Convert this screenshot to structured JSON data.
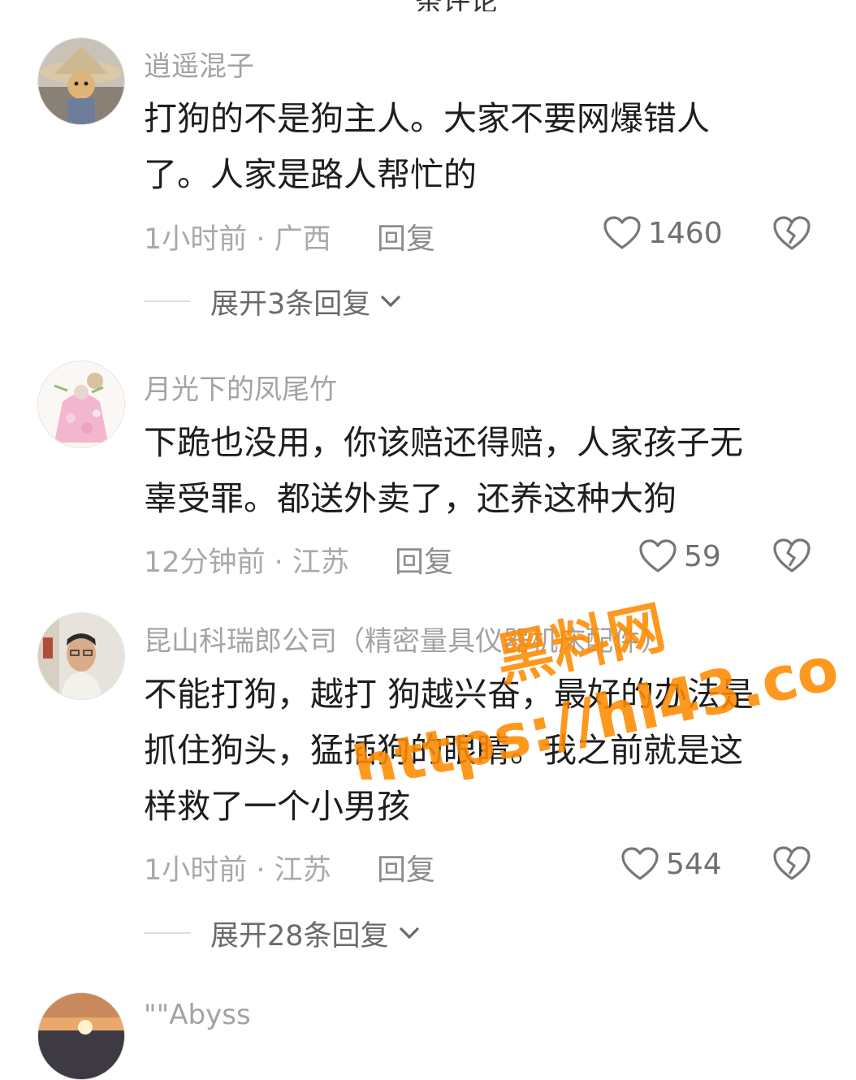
{
  "header": {
    "partial_title": "条评论"
  },
  "comments": [
    {
      "username": "逍遥混子",
      "lines": [
        "打狗的不是狗主人。大家不要网爆错人",
        "了。人家是路人帮忙的"
      ],
      "time_location": "1小时前 · 广西",
      "reply_label": "回复",
      "likes": "1460",
      "expand_label": "展开3条回复"
    },
    {
      "username": "月光下的凤尾竹",
      "lines": [
        "下跪也没用，你该赔还得赔，人家孩子无",
        "辜受罪。都送外卖了，还养这种大狗"
      ],
      "time_location": "12分钟前 · 江苏",
      "reply_label": "回复",
      "likes": "59"
    },
    {
      "username": "昆山科瑞郎公司（精密量具仪器机床配件）",
      "lines": [
        "不能打狗，越打 狗越兴奋，最好的办法是",
        "抓住狗头，猛插狗的眼睛。我之前就是这",
        "样救了一个小男孩"
      ],
      "time_location": "1小时前 · 江苏",
      "reply_label": "回复",
      "likes": "544",
      "expand_label": "展开28条回复"
    },
    {
      "username": "\"\"Abyss"
    }
  ],
  "watermark": {
    "line1": "黑料网",
    "line2": "https://hl43.co",
    "color": "#ff8a00"
  },
  "icons": {
    "like": "heart-outline-icon",
    "dislike": "broken-heart-icon",
    "expand": "chevron-down-icon"
  }
}
